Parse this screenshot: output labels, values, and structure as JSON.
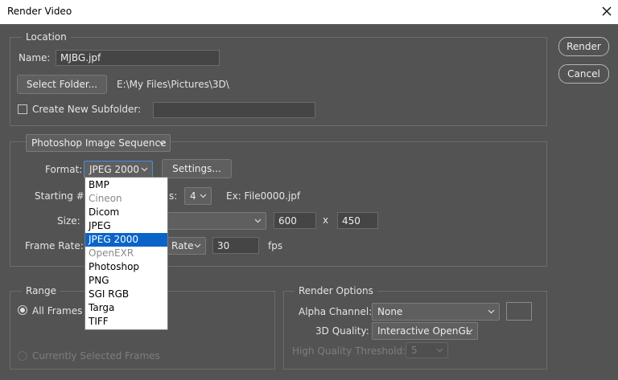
{
  "window": {
    "title": "Render Video"
  },
  "buttons": {
    "render": "Render",
    "cancel": "Cancel"
  },
  "location": {
    "legend": "Location",
    "name_label": "Name:",
    "name_value": "MJBG.jpf",
    "select_folder": "Select Folder...",
    "folder_path": "E:\\My Files\\Pictures\\3D\\",
    "subfolder_label": "Create New Subfolder:",
    "subfolder_value": ""
  },
  "sequence": {
    "type": "Photoshop Image Sequence",
    "format_label": "Format:",
    "format_value": "JPEG 2000",
    "settings": "Settings...",
    "starting_label": "Starting #:",
    "digits_partial": "s:",
    "digits_value": "4",
    "example": "Ex: File0000.jpf",
    "size_label": "Size:",
    "width": "600",
    "x_sep": "x",
    "height": "450",
    "frame_rate_label": "Frame Rate:",
    "rate_partial": "Rate",
    "fps_value": "30",
    "fps_unit": "fps"
  },
  "format_options": [
    {
      "label": "BMP",
      "state": "enabled"
    },
    {
      "label": "Cineon",
      "state": "disabled"
    },
    {
      "label": "Dicom",
      "state": "enabled"
    },
    {
      "label": "JPEG",
      "state": "enabled"
    },
    {
      "label": "JPEG 2000",
      "state": "selected"
    },
    {
      "label": "OpenEXR",
      "state": "disabled"
    },
    {
      "label": "Photoshop",
      "state": "enabled"
    },
    {
      "label": "PNG",
      "state": "enabled"
    },
    {
      "label": "SGI RGB",
      "state": "enabled"
    },
    {
      "label": "Targa",
      "state": "enabled"
    },
    {
      "label": "TIFF",
      "state": "enabled"
    }
  ],
  "range": {
    "legend": "Range",
    "all_frames": "All Frames",
    "selected_frames": "Currently Selected Frames"
  },
  "render_options": {
    "legend": "Render Options",
    "alpha_label": "Alpha Channel:",
    "alpha_value": "None",
    "quality_label": "3D Quality:",
    "quality_value": "Interactive OpenGL",
    "threshold_label": "High Quality Threshold:",
    "threshold_value": "5"
  },
  "colors": {
    "background": "#535353",
    "selection": "#0a64c8"
  }
}
